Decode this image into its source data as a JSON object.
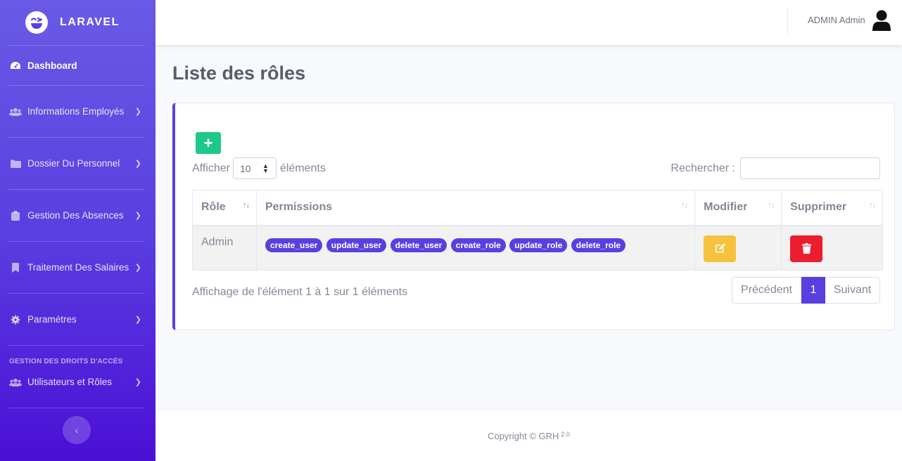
{
  "brand": {
    "name": "LARAVEL"
  },
  "sidebar": {
    "dashboard": {
      "label": "Dashboard",
      "icon": "tachometer-icon"
    },
    "items": [
      {
        "label": "Informations Employés",
        "icon": "users-icon"
      },
      {
        "label": "Dossier Du Personnel",
        "icon": "folder-icon"
      },
      {
        "label": "Gestion Des Absences",
        "icon": "clipboard-icon"
      },
      {
        "label": "Traitement Des Salaires",
        "icon": "bookmark-icon"
      },
      {
        "label": "Paramétres",
        "icon": "gear-icon"
      }
    ],
    "section_heading": "GESTION DES DROITS D'ACCÉS",
    "access_item": {
      "label": "Utilisateurs et Rôles",
      "icon": "users-icon"
    }
  },
  "topbar": {
    "user_name": "ADMIN Admin"
  },
  "page": {
    "title": "Liste des rôles"
  },
  "table_controls": {
    "show_prefix": "Afficher",
    "page_size": "10",
    "show_suffix": "éléments",
    "search_label": "Rechercher :",
    "search_value": ""
  },
  "table": {
    "headers": [
      "Rôle",
      "Permissions",
      "Modifier",
      "Supprimer"
    ],
    "rows": [
      {
        "role": "Admin",
        "permissions": [
          "create_user",
          "update_user",
          "delete_user",
          "create_role",
          "update_role",
          "delete_role"
        ]
      }
    ]
  },
  "footer_info": "Affichage de l'élément 1 à 1 sur 1 éléments",
  "pagination": {
    "prev": "Précédent",
    "current": "1",
    "next": "Suivant"
  },
  "footer": {
    "copyright": "Copyright © GRH",
    "version": "2.0"
  },
  "colors": {
    "primary": "#5a3fe0",
    "success": "#1cc88a",
    "warning": "#f6c23e",
    "danger": "#ec1d2f"
  }
}
